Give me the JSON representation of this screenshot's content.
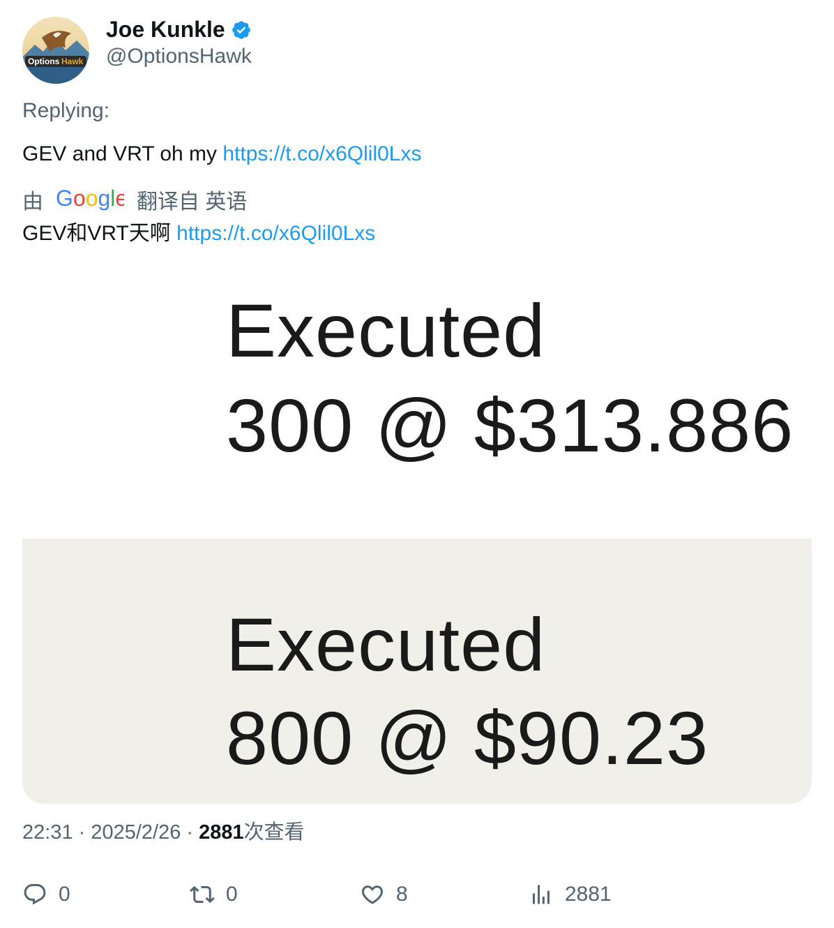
{
  "author": {
    "name": "Joe Kunkle",
    "handle": "@OptionsHawk",
    "avatar_icon": "optionshawk-logo-avatar",
    "verified_icon": "verified-badge-icon"
  },
  "replying_label": "Replying:",
  "tweet": {
    "text": "GEV and VRT oh my ",
    "link": "https://t.co/x6Qlil0Lxs"
  },
  "translation": {
    "by_label": "由",
    "provider_icon": "google-logo",
    "from_label": "翻译自 英语",
    "text": "GEV和VRT天啊 ",
    "link": "https://t.co/x6Qlil0Lxs"
  },
  "media": {
    "top": {
      "label": "Executed",
      "value": "300 @ $313.886",
      "background": "#ffffff"
    },
    "bottom": {
      "label": "Executed",
      "value": "800 @ $90.23",
      "background": "#f0efea"
    }
  },
  "meta": {
    "time": "22:31",
    "separator": " · ",
    "date": "2025/2/26",
    "views_count": "2881",
    "views_label": "次查看"
  },
  "actions": {
    "reply": {
      "icon": "reply-icon",
      "count": "0"
    },
    "retweet": {
      "icon": "retweet-icon",
      "count": "0"
    },
    "like": {
      "icon": "heart-icon",
      "count": "8"
    },
    "views": {
      "icon": "analytics-icon",
      "count": "2881"
    }
  },
  "colors": {
    "link": "#1d9bf0",
    "secondary_text": "#536471",
    "primary_text": "#0f1419",
    "verified": "#1d9bf0"
  }
}
